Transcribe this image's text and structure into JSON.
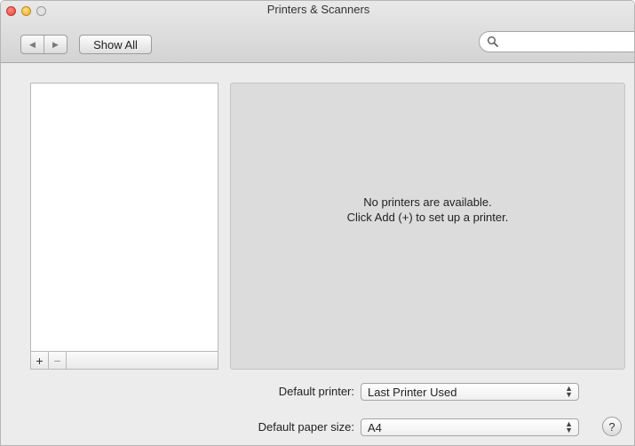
{
  "window": {
    "title": "Printers & Scanners"
  },
  "toolbar": {
    "back_icon": "back-arrow-icon",
    "forward_icon": "forward-arrow-icon",
    "show_all_label": "Show All",
    "search": {
      "value": "",
      "placeholder": "",
      "icon": "magnifier-icon"
    }
  },
  "printer_list": {
    "items": [],
    "add_label": "+",
    "remove_label": "−"
  },
  "detail": {
    "empty_line1": "No printers are available.",
    "empty_line2": "Click Add (+) to set up a printer."
  },
  "defaults": {
    "printer_label": "Default printer:",
    "printer_value": "Last Printer Used",
    "paper_label": "Default paper size:",
    "paper_value": "A4",
    "help_label": "?"
  },
  "colors": {
    "close_light": "#e0443a",
    "minimize_light": "#e7a923",
    "window_bg": "#ececec",
    "detail_bg": "#dcdcdc"
  }
}
